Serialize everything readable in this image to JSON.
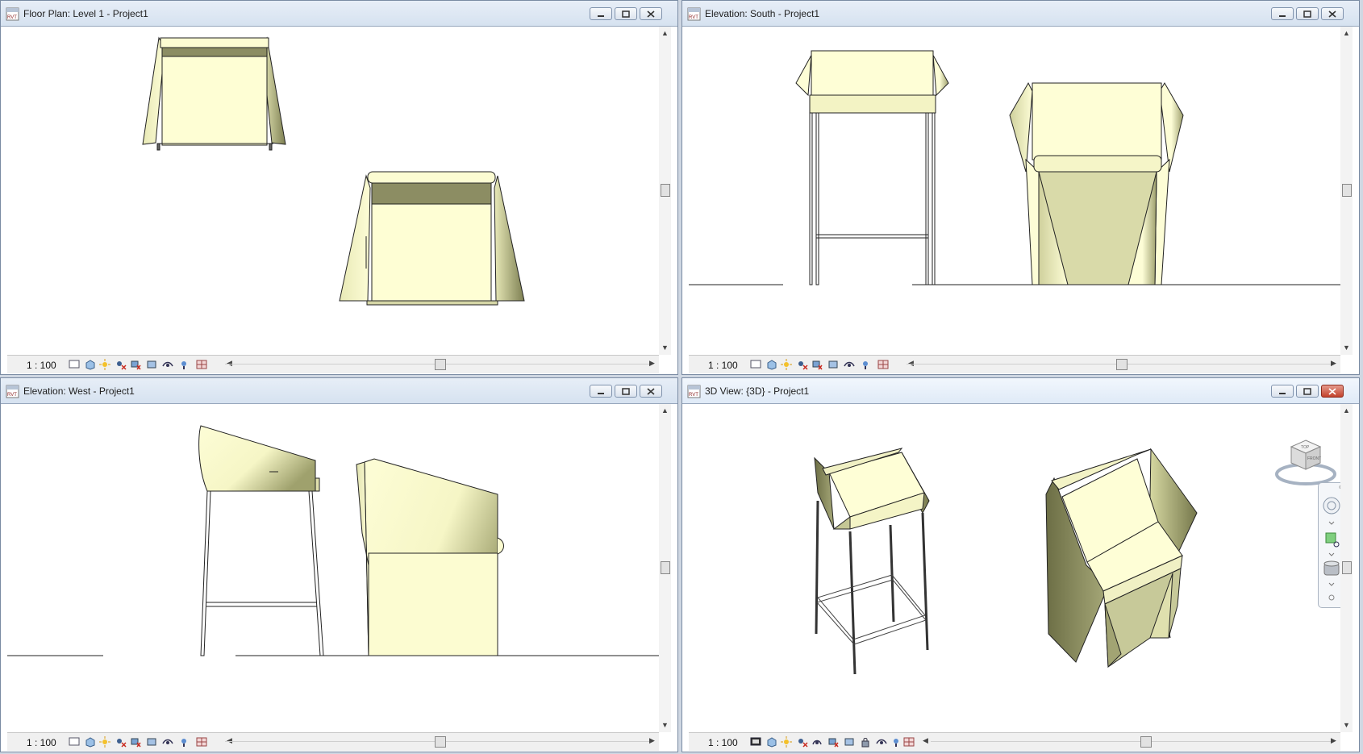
{
  "windows": [
    {
      "id": "floor-plan",
      "title": "Floor Plan: Level 1 - Project1",
      "scale": "1 : 100"
    },
    {
      "id": "elevation-south",
      "title": "Elevation: South - Project1",
      "scale": "1 : 100"
    },
    {
      "id": "elevation-west",
      "title": "Elevation: West - Project1",
      "scale": "1 : 100"
    },
    {
      "id": "3d-view",
      "title": "3D View: {3D} - Project1",
      "scale": "1 : 100",
      "active": true
    }
  ],
  "app_icon_text": "RVT",
  "viewcube": {
    "top_label": "TOP",
    "front_label": "FRONT"
  },
  "icons": [
    "detail-level-icon",
    "visual-style-icon",
    "sun-path-icon",
    "shadows-icon",
    "crop-view-icon",
    "show-crop-icon",
    "temp-hide-icon",
    "reveal-hidden-icon",
    "analysis-icon"
  ],
  "colors": {
    "chair_fill": "#fdfdd3",
    "chair_shade": "#a9ab7a",
    "title_bar": "#dce6f2",
    "close_active": "#c9452f"
  }
}
